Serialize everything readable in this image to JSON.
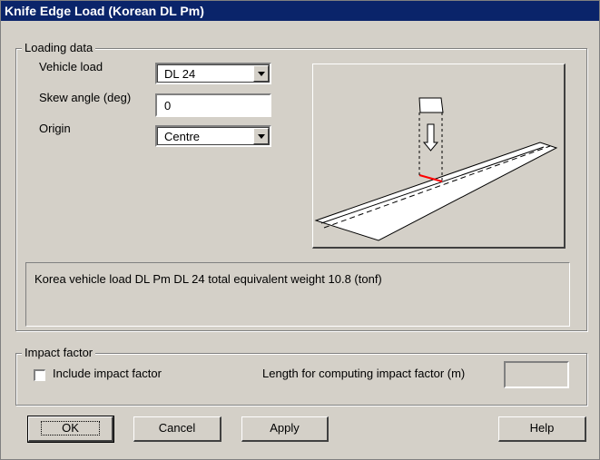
{
  "window": {
    "title": "Knife Edge Load (Korean DL Pm)"
  },
  "loading_data": {
    "legend": "Loading data",
    "vehicle_load": {
      "label": "Vehicle load",
      "value": "DL 24"
    },
    "skew_angle": {
      "label": "Skew angle (deg)",
      "value": "0"
    },
    "origin": {
      "label": "Origin",
      "value": "Centre"
    },
    "info_text": "Korea vehicle load DL Pm DL 24 total equivalent weight 10.8 (tonf)"
  },
  "impact_factor": {
    "legend": "Impact factor",
    "include_label": "Include impact factor",
    "include_checked": false,
    "length_label": "Length for computing impact factor (m)",
    "length_value": ""
  },
  "buttons": {
    "ok": "OK",
    "cancel": "Cancel",
    "apply": "Apply",
    "help": "Help"
  },
  "colors": {
    "title_bar": "#0a246a",
    "face": "#d4d0c8",
    "highlight_line": "#ff0000"
  }
}
